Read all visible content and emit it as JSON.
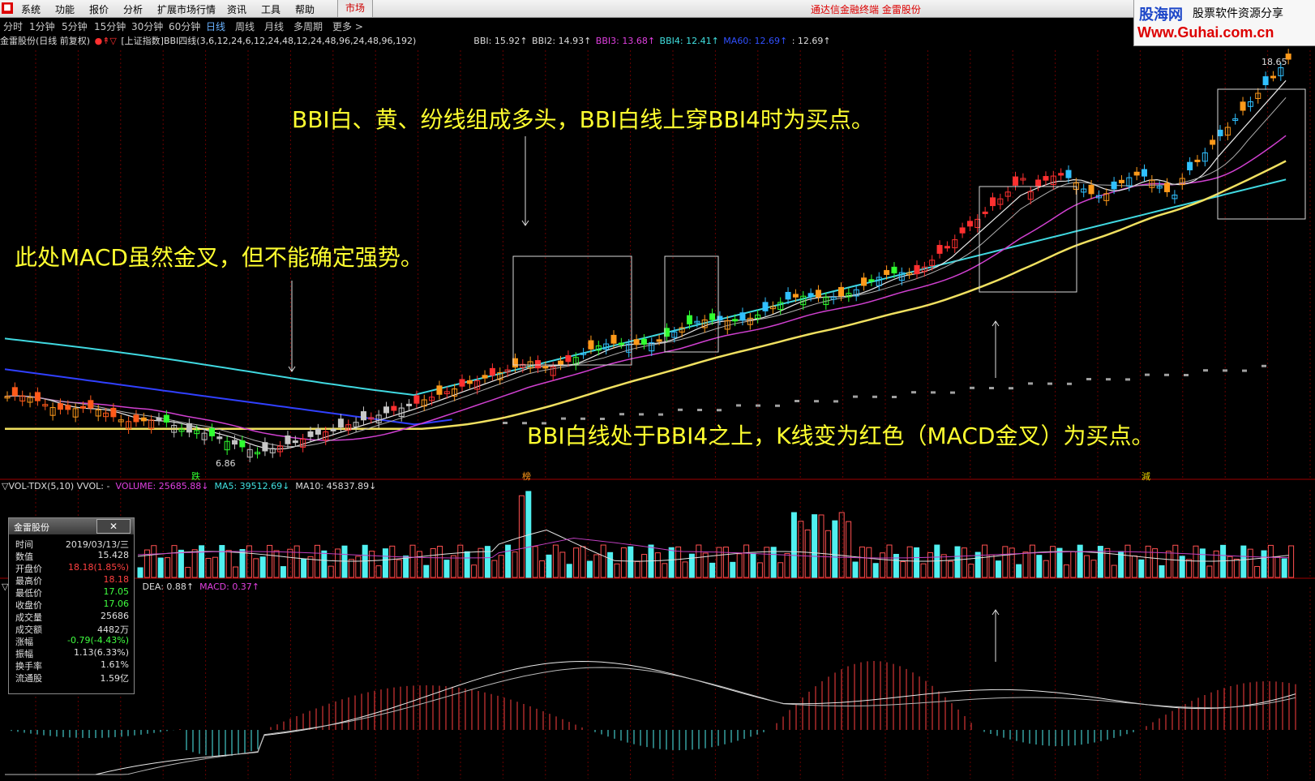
{
  "menu": {
    "logo": "■",
    "items": [
      "系统",
      "功能",
      "报价",
      "分析",
      "扩展市场行情",
      "资讯",
      "工具",
      "帮助"
    ],
    "market": "市场",
    "app_title": "通达信金融终端  金雷股份"
  },
  "brand": {
    "cn": "股海网",
    "slogan": "股票软件资源分享",
    "url": "Www.Guhai.com.cn"
  },
  "periods": {
    "items": [
      "分时",
      "1分钟",
      "5分钟",
      "15分钟",
      "30分钟",
      "60分钟",
      "日线",
      "周线",
      "月线",
      "多周期",
      "更多 >"
    ],
    "active": "日线"
  },
  "indicator": {
    "stock": "金雷股份(日线 前复权)",
    "formula": "[上证指数]BBI四线(3,6,12,24,6,12,24,48,12,24,48,96,24,48,96,192)",
    "bbi": "BBI: 15.92↑",
    "bbi2": "BBI2: 14.93↑",
    "bbi3": "BBI3: 13.68↑",
    "bbi4": "BBI4: 12.41↑",
    "ma60": "MA60: 12.69↑",
    "extra": ": 12.69↑"
  },
  "price_labels": {
    "high": "18.65",
    "low": "6.86"
  },
  "markers": {
    "m1": "跌",
    "m2": "榜",
    "m3": "減"
  },
  "annotations": {
    "a1": "BBI白、黄、纷线组成多头，BBI白线上穿BBI4时为买点。",
    "a2": "此处MACD虽然金叉，但不能确定强势。",
    "a3": "BBI白线处于BBI4之上，K线变为红色（MACD金叉）为买点。"
  },
  "volume": {
    "name": "▽VOL-TDX(5,10)",
    "vol_label": "VVOL: -",
    "volume": "VOLUME: 25685.88↓",
    "ma5": "MA5: 39512.69↓",
    "ma10": "MA10: 45837.89↓"
  },
  "macd": {
    "prefix": "▽",
    "dea": "DEA: 0.88↑",
    "macd": "MACD: 0.37↑"
  },
  "infobox": {
    "title": "金雷股份",
    "close": "✕",
    "rows": [
      {
        "k": "时间",
        "v": "2019/03/13/三",
        "c": ""
      },
      {
        "k": "数值",
        "v": "15.428",
        "c": ""
      },
      {
        "k": "开盘价",
        "v": "18.18(1.85%)",
        "c": "red"
      },
      {
        "k": "最高价",
        "v": "18.18",
        "c": "red"
      },
      {
        "k": "最低价",
        "v": "17.05",
        "c": "green"
      },
      {
        "k": "收盘价",
        "v": "17.06",
        "c": "green"
      },
      {
        "k": "成交量",
        "v": "25686",
        "c": ""
      },
      {
        "k": "成交额",
        "v": "4482万",
        "c": ""
      },
      {
        "k": "涨幅",
        "v": "-0.79(-4.43%)",
        "c": "green"
      },
      {
        "k": "振幅",
        "v": "1.13(6.33%)",
        "c": ""
      },
      {
        "k": "换手率",
        "v": "1.61%",
        "c": ""
      },
      {
        "k": "流通股",
        "v": "1.59亿",
        "c": ""
      }
    ]
  },
  "colors": {
    "up": "#ff3030",
    "down": "#30c0ff",
    "green_candle": "#30ff30",
    "orange": "#ff9a1a",
    "bbi_white": "#e8e8e8",
    "bbi_yellow": "#f0e060",
    "bbi_magenta": "#d040d0",
    "bbi_cyan": "#40d8e0",
    "ma60_blue": "#3040ff"
  }
}
